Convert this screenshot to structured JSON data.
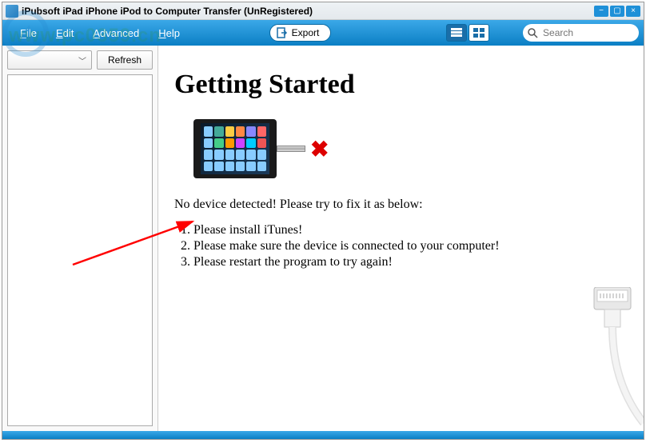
{
  "titlebar": {
    "title": "iPubsoft iPad iPhone iPod to Computer Transfer (UnRegistered)"
  },
  "menu": {
    "file": "File",
    "edit": "Edit",
    "advanced": "Advanced",
    "help": "Help"
  },
  "toolbar": {
    "export_label": "Export",
    "search_placeholder": "Search"
  },
  "sidebar": {
    "refresh_label": "Refresh"
  },
  "main": {
    "heading": "Getting Started",
    "no_device_msg": "No device detected! Please try to fix it as below:",
    "steps": [
      "Please install iTunes!",
      "Please make sure the device is connected to your computer!",
      "Please restart the program to try again!"
    ]
  }
}
